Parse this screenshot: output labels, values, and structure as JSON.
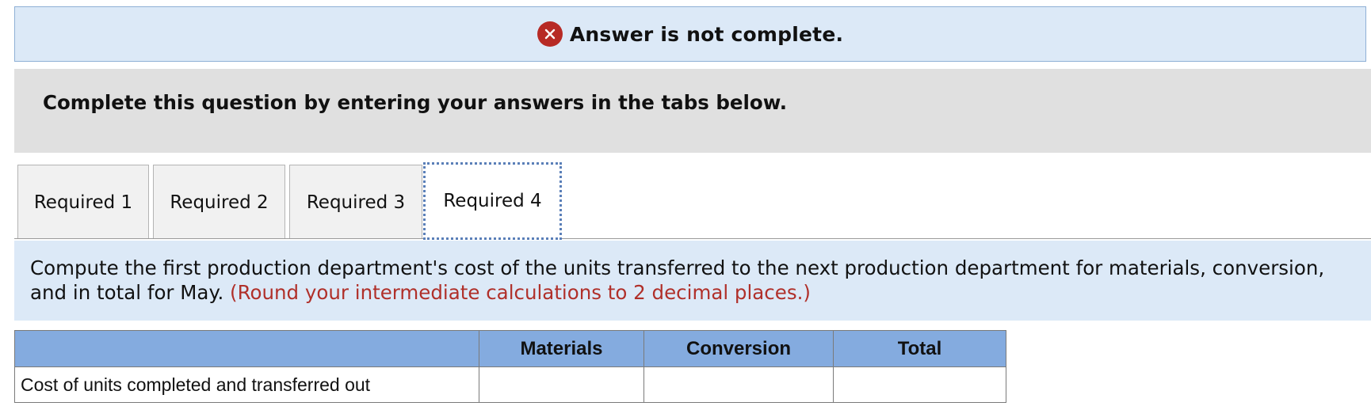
{
  "banner": {
    "status_text": "Answer is not complete.",
    "icon": "x-circle-icon",
    "icon_color": "#b72a25",
    "background_color": "#dce9f7"
  },
  "instructions": {
    "text": "Complete this question by entering your answers in the tabs below."
  },
  "tabs": [
    {
      "label": "Required 1",
      "active": false
    },
    {
      "label": "Required 2",
      "active": false
    },
    {
      "label": "Required 3",
      "active": false
    },
    {
      "label": "Required 4",
      "active": true
    }
  ],
  "question": {
    "text": "Compute the first production department's cost of the units transferred to the next production department for materials, conversion, and in total for May.",
    "note": "(Round your intermediate calculations to 2 decimal places.)",
    "note_color": "#b0302a"
  },
  "table": {
    "header_color": "#84abdf",
    "columns": [
      "",
      "Materials",
      "Conversion",
      "Total"
    ],
    "rows": [
      {
        "label": "Cost of units completed and transferred out",
        "values": [
          "",
          "",
          ""
        ]
      }
    ]
  }
}
